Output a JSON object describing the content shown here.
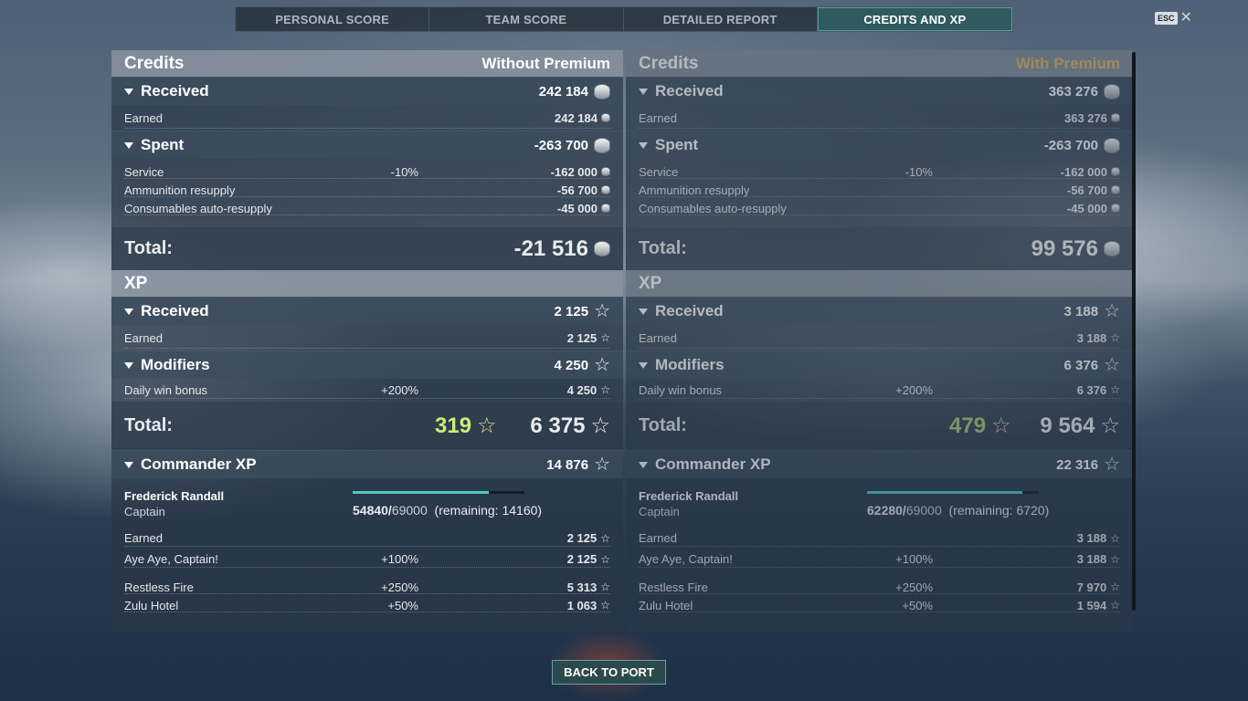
{
  "tabs": [
    "PERSONAL SCORE",
    "TEAM SCORE",
    "DETAILED REPORT",
    "CREDITS AND XP"
  ],
  "active_tab": "CREDITS AND XP",
  "esc": {
    "key": "ESC",
    "close": "✕"
  },
  "panels": [
    {
      "credits_title": "Credits",
      "variant": "Without Premium",
      "received": {
        "label": "Received",
        "value": "242 184"
      },
      "earned": {
        "label": "Earned",
        "value": "242 184"
      },
      "spent": {
        "label": "Spent",
        "value": "-263 700"
      },
      "service": {
        "label": "Service",
        "pct": "-10%",
        "value": "-162 000"
      },
      "ammo": {
        "label": "Ammunition resupply",
        "value": "-56 700"
      },
      "consumables": {
        "label": "Consumables auto-resupply",
        "value": "-45 000"
      },
      "credits_total": {
        "label": "Total:",
        "value": "-21 516"
      },
      "xp_title": "XP",
      "xp_received": {
        "label": "Received",
        "value": "2 125"
      },
      "xp_earned": {
        "label": "Earned",
        "value": "2 125"
      },
      "modifiers": {
        "label": "Modifiers",
        "value": "4 250"
      },
      "daily": {
        "label": "Daily win bonus",
        "pct": "+200%",
        "value": "4 250"
      },
      "xp_total": {
        "label": "Total:",
        "free": "319",
        "value": "6 375"
      },
      "commander": {
        "label": "Commander XP",
        "value": "14 876"
      },
      "captain": {
        "name": "Frederick Randall",
        "rank": "Captain",
        "current": "54840/",
        "max": "69000",
        "remaining": "(remaining: 14160)",
        "progress": 0.795
      },
      "c_earned": {
        "label": "Earned",
        "value": "2 125"
      },
      "aye": {
        "label": "Aye Aye, Captain!",
        "pct": "+100%",
        "value": "2 125"
      },
      "restless": {
        "label": "Restless Fire",
        "pct": "+250%",
        "value": "5 313"
      },
      "zulu": {
        "label": "Zulu Hotel",
        "pct": "+50%",
        "value": "1 063"
      }
    },
    {
      "credits_title": "Credits",
      "variant": "With Premium",
      "received": {
        "label": "Received",
        "value": "363 276"
      },
      "earned": {
        "label": "Earned",
        "value": "363 276"
      },
      "spent": {
        "label": "Spent",
        "value": "-263 700"
      },
      "service": {
        "label": "Service",
        "pct": "-10%",
        "value": "-162 000"
      },
      "ammo": {
        "label": "Ammunition resupply",
        "value": "-56 700"
      },
      "consumables": {
        "label": "Consumables auto-resupply",
        "value": "-45 000"
      },
      "credits_total": {
        "label": "Total:",
        "value": "99 576"
      },
      "xp_title": "XP",
      "xp_received": {
        "label": "Received",
        "value": "3 188"
      },
      "xp_earned": {
        "label": "Earned",
        "value": "3 188"
      },
      "modifiers": {
        "label": "Modifiers",
        "value": "6 376"
      },
      "daily": {
        "label": "Daily win bonus",
        "pct": "+200%",
        "value": "6 376"
      },
      "xp_total": {
        "label": "Total:",
        "free": "479",
        "value": "9 564"
      },
      "commander": {
        "label": "Commander XP",
        "value": "22 316"
      },
      "captain": {
        "name": "Frederick Randall",
        "rank": "Captain",
        "current": "62280/",
        "max": "69000",
        "remaining": "(remaining: 6720)",
        "progress": 0.9026
      },
      "c_earned": {
        "label": "Earned",
        "value": "3 188"
      },
      "aye": {
        "label": "Aye Aye, Captain!",
        "pct": "+100%",
        "value": "3 188"
      },
      "restless": {
        "label": "Restless Fire",
        "pct": "+250%",
        "value": "7 970"
      },
      "zulu": {
        "label": "Zulu Hotel",
        "pct": "+50%",
        "value": "1 594"
      }
    }
  ],
  "back_button": "BACK TO PORT",
  "colors": {
    "accent": "#4fc8c4",
    "premium": "#e0b45a",
    "free_xp": "#c8ee7a"
  },
  "icons": {
    "credits": "credits-coin-icon",
    "xp": "xp-star-icon"
  }
}
